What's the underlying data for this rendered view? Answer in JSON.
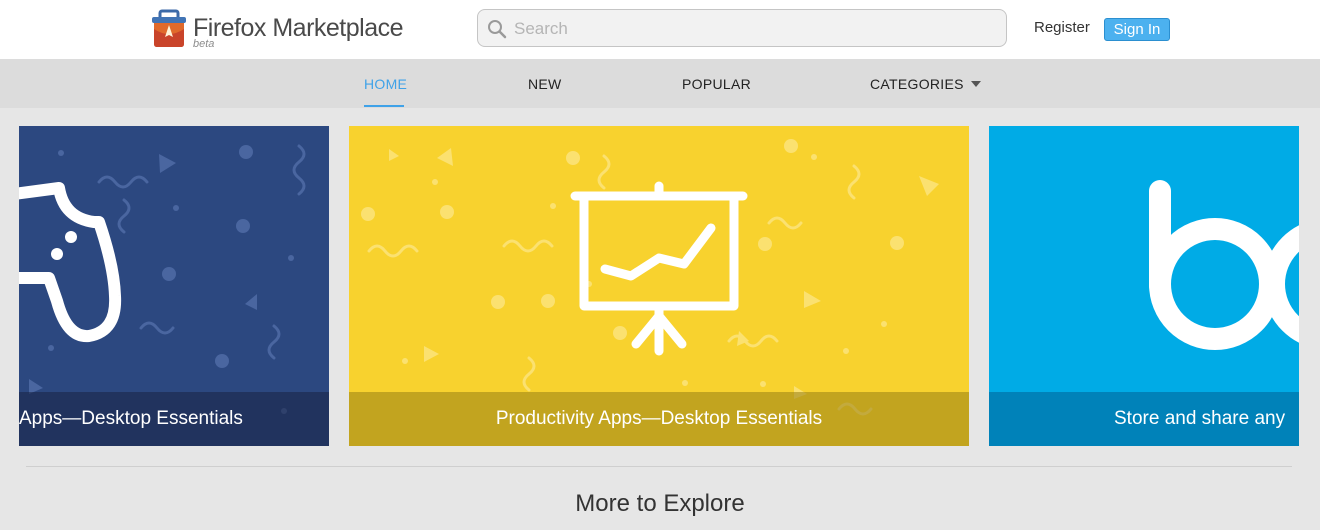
{
  "header": {
    "brand": "Firefox",
    "product": " Marketplace",
    "badge": "beta",
    "search_placeholder": "Search",
    "register_label": "Register",
    "signin_label": "Sign In"
  },
  "nav": {
    "items": [
      {
        "label": "HOME",
        "active": true
      },
      {
        "label": "NEW"
      },
      {
        "label": "POPULAR"
      },
      {
        "label": "CATEGORIES",
        "has_dropdown": true
      }
    ]
  },
  "carousel": {
    "cards": [
      {
        "caption": "Apps—Desktop Essentials",
        "icon": "gamepad-icon",
        "color": "#2c4880"
      },
      {
        "caption": "Productivity Apps—Desktop Essentials",
        "icon": "presentation-chart-icon",
        "color": "#f8d22e"
      },
      {
        "caption": "Store and share any",
        "icon": "box-logo-icon",
        "color": "#00abe6"
      }
    ]
  },
  "section": {
    "title": "More to Explore"
  },
  "colors": {
    "accent": "#3fa2e8",
    "signin": "#4cb1ef"
  }
}
